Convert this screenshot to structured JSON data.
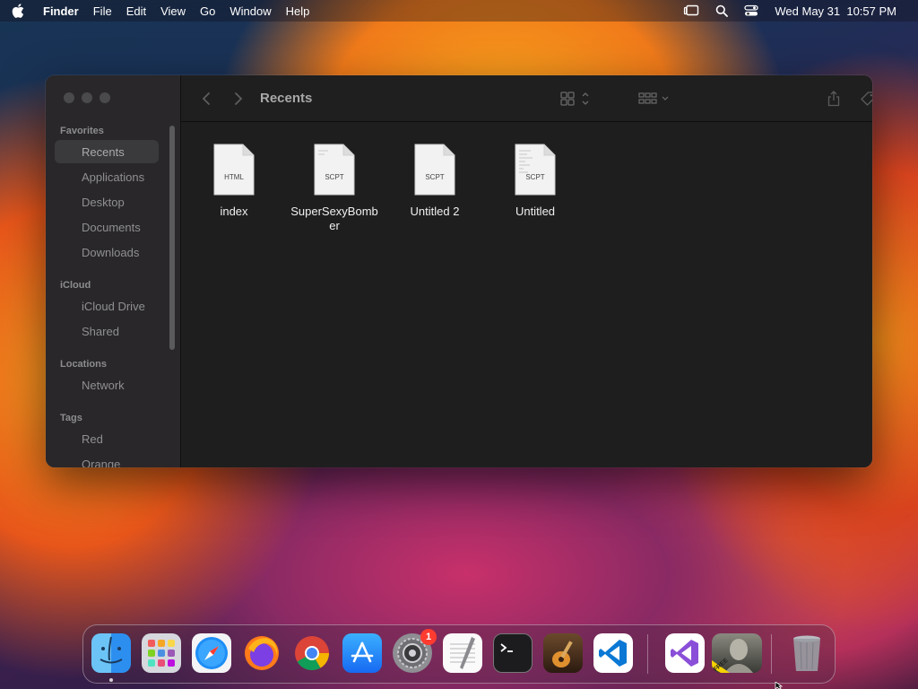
{
  "menubar": {
    "app_name": "Finder",
    "items": [
      "File",
      "Edit",
      "View",
      "Go",
      "Window",
      "Help"
    ],
    "datetime": "Wed May 31  10:57 PM"
  },
  "window": {
    "title": "Recents",
    "sidebar": {
      "favorites_header": "Favorites",
      "favorites": [
        "Recents",
        "Applications",
        "Desktop",
        "Documents",
        "Downloads"
      ],
      "icloud_header": "iCloud",
      "icloud": [
        "iCloud Drive",
        "Shared"
      ],
      "locations_header": "Locations",
      "locations": [
        "Network"
      ],
      "tags_header": "Tags",
      "tags": [
        "Red",
        "Orange"
      ]
    },
    "files": [
      {
        "name": "index",
        "type": "HTML"
      },
      {
        "name": "SuperSexyBomber",
        "type": "SCPT"
      },
      {
        "name": "Untitled 2",
        "type": "SCPT"
      },
      {
        "name": "Untitled",
        "type": "SCPT"
      }
    ]
  },
  "dock": {
    "apps": [
      "finder-icon",
      "launchpad-icon",
      "safari-icon",
      "firefox-icon",
      "chrome-icon",
      "app-store-icon",
      "system-settings-icon",
      "textedit-icon",
      "terminal-icon",
      "garageband-icon",
      "vscode-icon",
      "visual-studio-icon",
      "free-app-icon",
      "trash-icon"
    ],
    "settings_badge": "1",
    "free_label": "FREE"
  },
  "colors": {
    "window_bg": "#1e1e1e",
    "sidebar_bg": "#2a282c",
    "selected_item": "#3a3a3c",
    "badge": "#ff3b30"
  }
}
